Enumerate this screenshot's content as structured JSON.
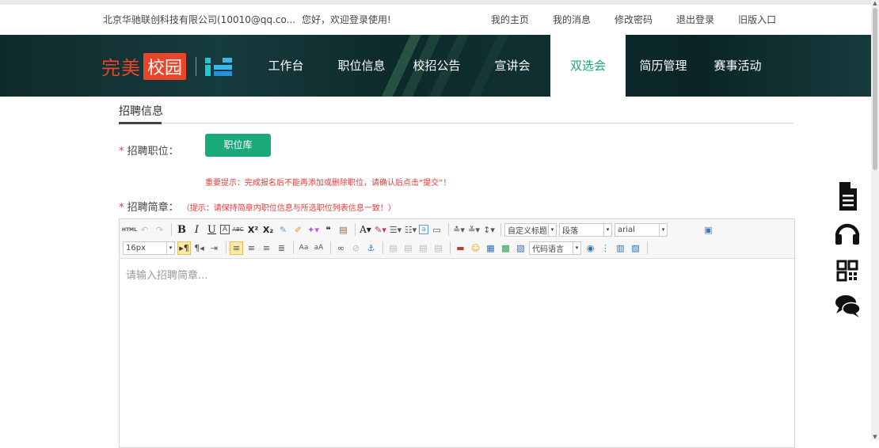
{
  "topbar": {
    "company": "北京华驰联创科技有限公司(10010@qq.co...",
    "welcome": "您好，欢迎登录使用!",
    "links": [
      "我的主页",
      "我的消息",
      "修改密码",
      "退出登录",
      "旧版入口"
    ]
  },
  "logo": {
    "part1": "完美",
    "part2": "校园"
  },
  "nav": [
    "工作台",
    "职位信息",
    "校招公告",
    "宣讲会",
    "双选会",
    "简历管理",
    "赛事活动"
  ],
  "active_nav": "双选会",
  "section_title": "招聘信息",
  "form": {
    "position_label": "招聘职位：",
    "position_button": "职位库",
    "warning": "重要提示：完成报名后不能再添加或删除职位，请确认后点击“提交”！",
    "brief_label": "招聘简章：",
    "brief_hint": "（提示：请保持简章内职位信息与所选职位列表信息一致！）",
    "required_mark": "*"
  },
  "editor": {
    "font_size": "16px",
    "custom_heading": "自定义标题",
    "paragraph": "段落",
    "font_family": "arial",
    "code_language": "代码语言",
    "placeholder": "请输入招聘简章..."
  },
  "colors": {
    "accent": "#19a97a",
    "warning": "#e4393c",
    "logo": "#e8452b"
  }
}
